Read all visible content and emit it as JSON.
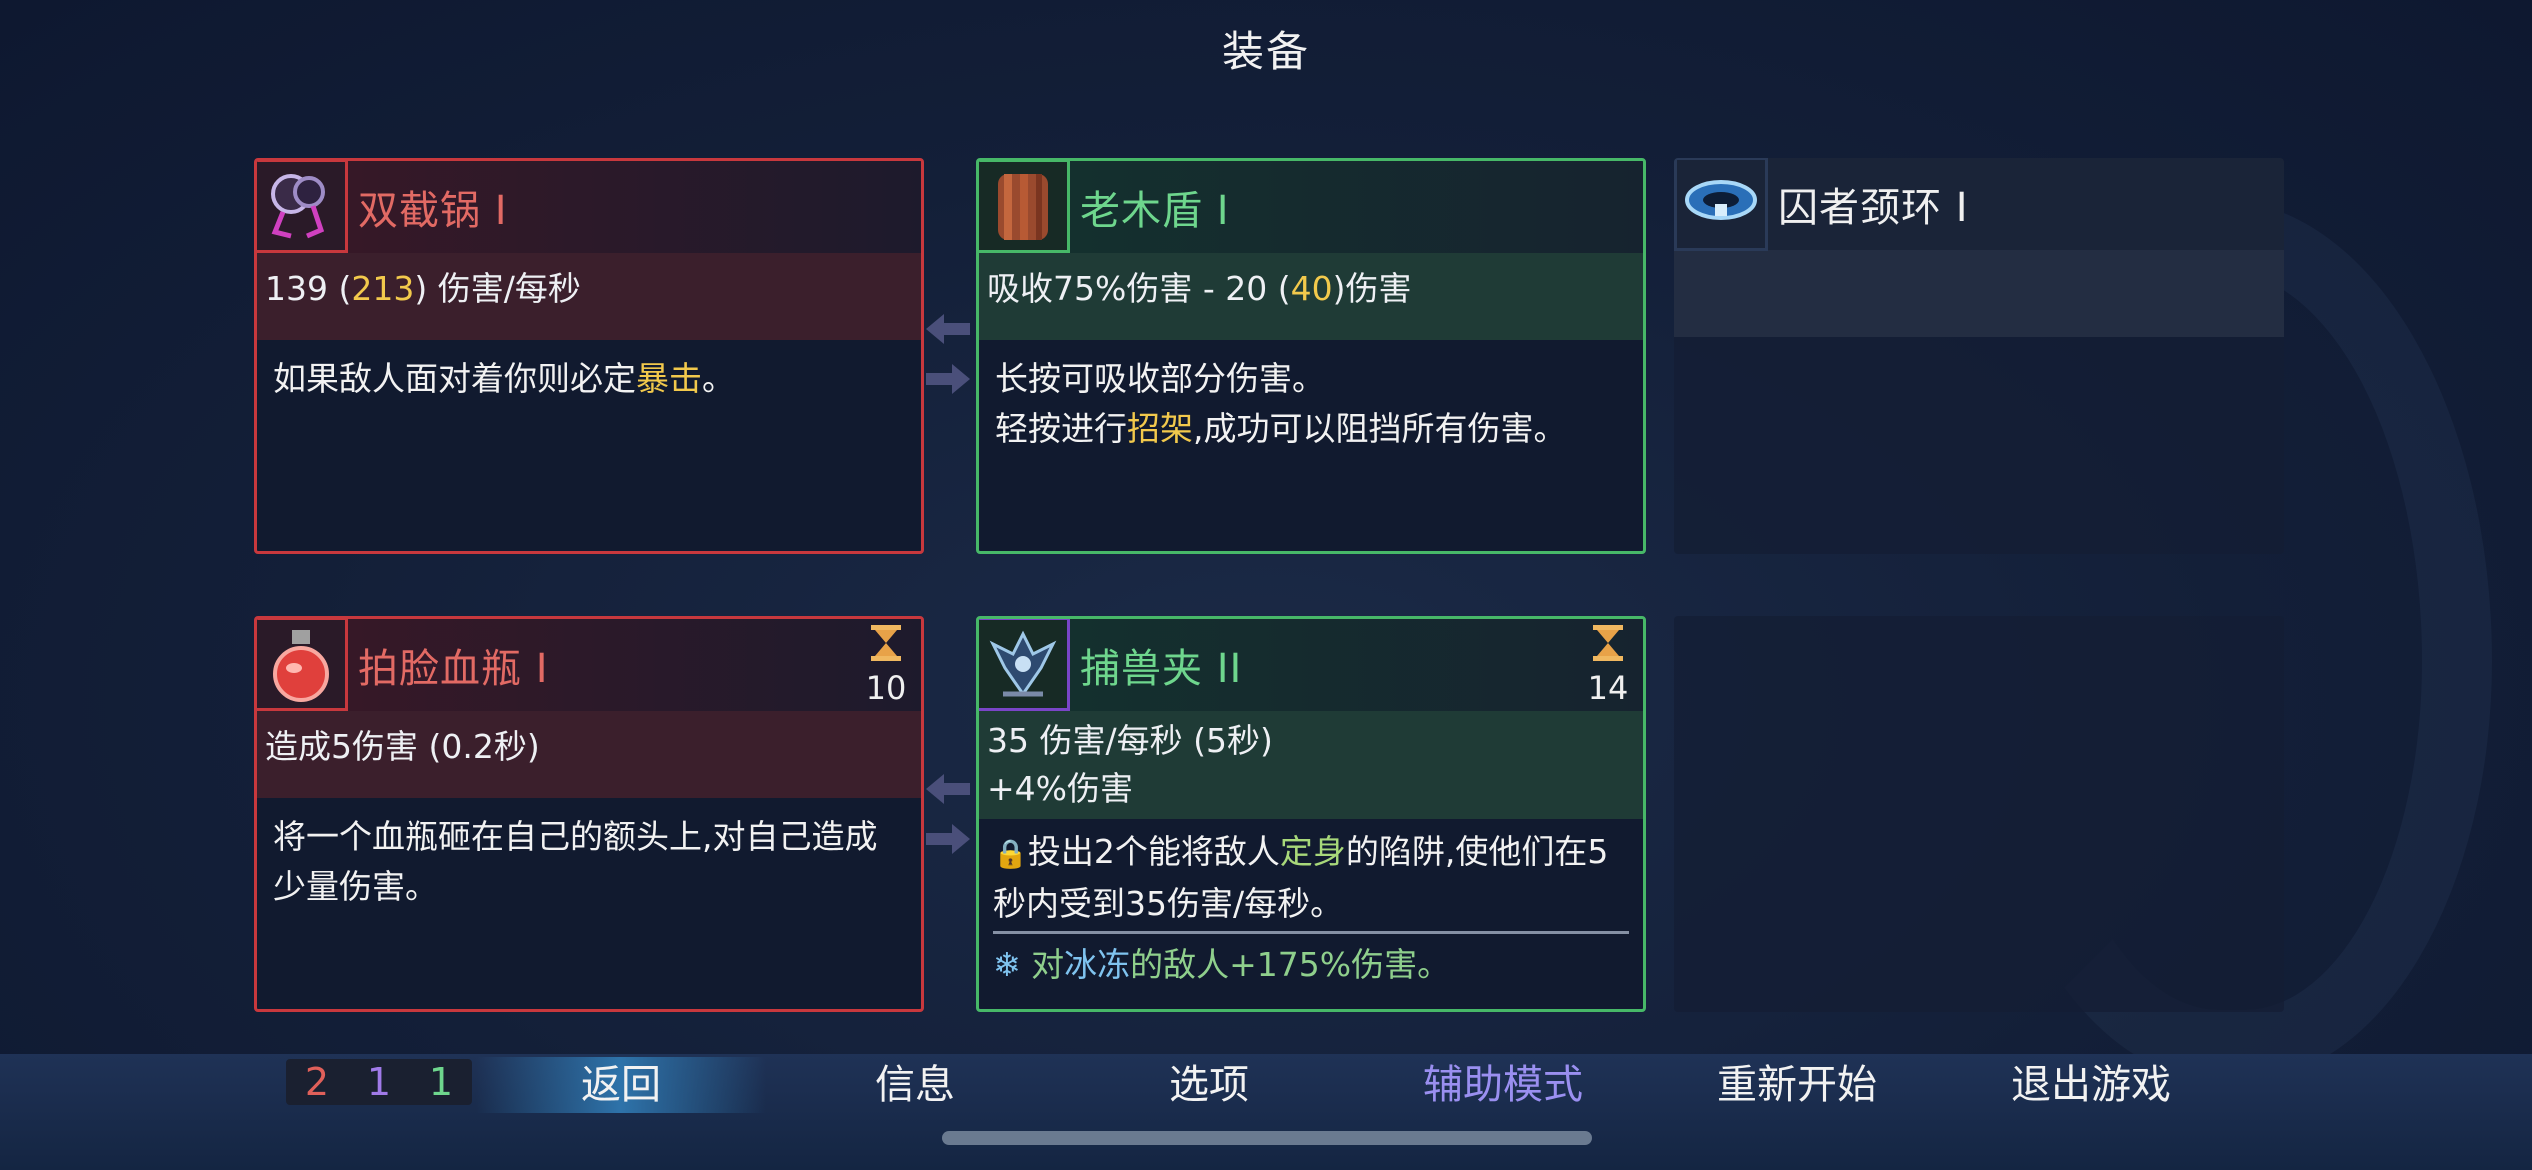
{
  "title": "装备",
  "colors": {
    "red_border": "#c8383d",
    "green_border": "#47b868",
    "highlight": "#f2c94c"
  },
  "cards": {
    "pan": {
      "icon": "frying-pans-icon",
      "name": "双截锅 I",
      "stat_base": "139 (",
      "stat_hl": "213",
      "stat_tail": ") 伤害/每秒",
      "desc_pre": "如果敌人面对着你则必定",
      "desc_hl": "暴击",
      "desc_post": "。"
    },
    "shield": {
      "icon": "wooden-shield-icon",
      "name": "老木盾 I",
      "stat_base": "吸收75%伤害 - 20 (",
      "stat_hl": "40",
      "stat_tail": ")伤害",
      "desc_line1": "长按可吸收部分伤害。",
      "desc_line2_pre": "轻按进行",
      "desc_line2_hl": "招架",
      "desc_line2_post": ",成功可以阻挡所有伤害。"
    },
    "collar": {
      "icon": "prisoner-collar-icon",
      "name": "囚者颈环 I"
    },
    "flask": {
      "icon": "blood-flask-icon",
      "name": "拍脸血瓶 I",
      "cooldown": "10",
      "stat": "造成5伤害 (0.2秒)",
      "desc": "将一个血瓶砸在自己的额头上,对自己造成少量伤害。"
    },
    "trap": {
      "icon": "wolf-trap-icon",
      "name": "捕兽夹 II",
      "cooldown": "14",
      "stat_line1": "35 伤害/每秒 (5秒)",
      "stat_line2": "+4%伤害",
      "desc_pre": "投出2个能将敌人",
      "desc_hl": "定身",
      "desc_post": "的陷阱,使他们在5秒内受到35伤害/每秒。",
      "bonus_pre": "对",
      "bonus_hl": "冰冻",
      "bonus_post": "的敌人+175%伤害。"
    }
  },
  "counter": {
    "red": "2",
    "purple": "1",
    "green": "1"
  },
  "menu": {
    "back": "返回",
    "info": "信息",
    "options": "选项",
    "assist": "辅助模式",
    "restart": "重新开始",
    "quit": "退出游戏"
  }
}
